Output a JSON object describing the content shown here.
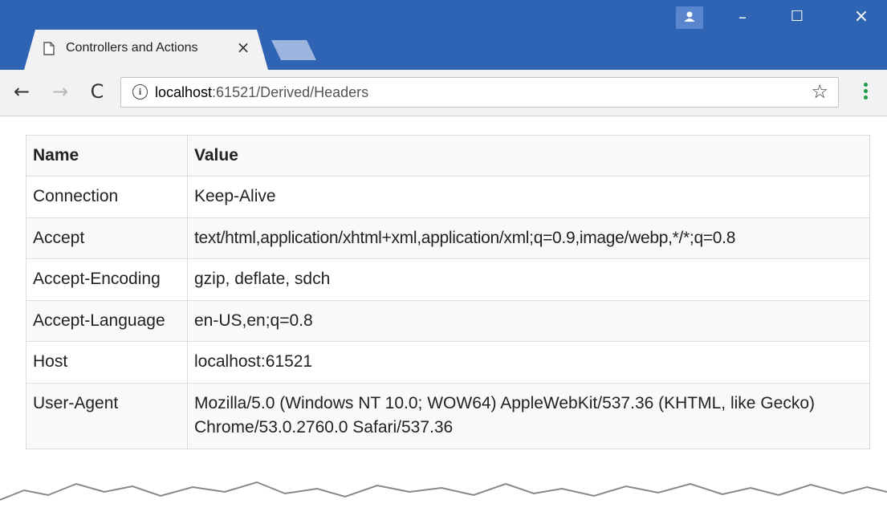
{
  "tab": {
    "title": "Controllers and Actions",
    "close_glyph": "×"
  },
  "window_controls": {
    "minimize": "–",
    "maximize": "☐",
    "close": "×"
  },
  "toolbar": {
    "back": "←",
    "forward": "→",
    "reload": "C",
    "info": "i",
    "url_host": "localhost",
    "url_rest": ":61521/Derived/Headers",
    "star": "☆"
  },
  "table": {
    "columns": [
      "Name",
      "Value"
    ],
    "rows": [
      {
        "name": "Connection",
        "value": "Keep-Alive"
      },
      {
        "name": "Accept",
        "value": "text/html,application/xhtml+xml,application/xml;q=0.9,image/webp,*/*;q=0.8"
      },
      {
        "name": "Accept-Encoding",
        "value": "gzip, deflate, sdch"
      },
      {
        "name": "Accept-Language",
        "value": "en-US,en;q=0.8"
      },
      {
        "name": "Host",
        "value": "localhost:61521"
      },
      {
        "name": "User-Agent",
        "value": "Mozilla/5.0 (Windows NT 10.0; WOW64) AppleWebKit/537.36 (KHTML, like Gecko) Chrome/53.0.2760.0 Safari/537.36"
      }
    ]
  },
  "colors": {
    "titlebar": "#2f63b4",
    "tab_active": "#f2f2f2",
    "menu_dots": "#1a9b3e"
  },
  "icons": [
    "page-icon",
    "close-icon",
    "profile-icon",
    "minimize-icon",
    "maximize-icon",
    "window-close-icon",
    "back-icon",
    "forward-icon",
    "reload-icon",
    "info-icon",
    "star-icon",
    "menu-icon"
  ]
}
